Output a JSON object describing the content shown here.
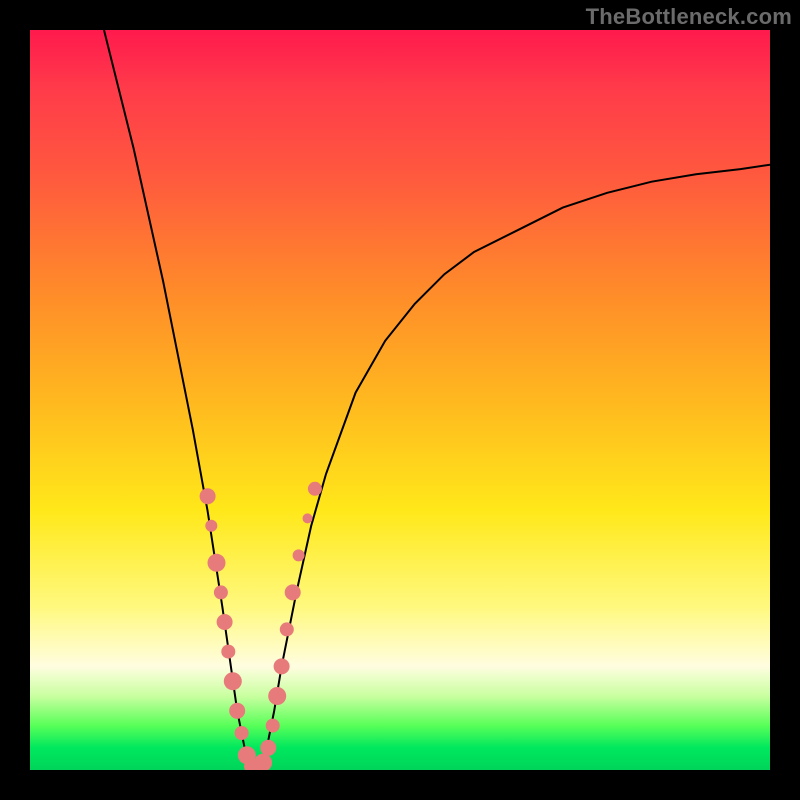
{
  "watermark": "TheBottleneck.com",
  "chart_data": {
    "type": "line",
    "title": "",
    "xlabel": "",
    "ylabel": "",
    "xlim": [
      0,
      100
    ],
    "ylim": [
      0,
      100
    ],
    "grid": false,
    "legend": false,
    "background_gradient_stops": [
      {
        "pos": 0,
        "color": "#ff1a4d"
      },
      {
        "pos": 8,
        "color": "#ff3b4a"
      },
      {
        "pos": 20,
        "color": "#ff5a3e"
      },
      {
        "pos": 35,
        "color": "#ff8a2a"
      },
      {
        "pos": 50,
        "color": "#ffb81f"
      },
      {
        "pos": 65,
        "color": "#ffe81a"
      },
      {
        "pos": 78,
        "color": "#fff97f"
      },
      {
        "pos": 86,
        "color": "#fffde0"
      },
      {
        "pos": 90,
        "color": "#c9ffa0"
      },
      {
        "pos": 94,
        "color": "#58ff58"
      },
      {
        "pos": 97,
        "color": "#00e85e"
      },
      {
        "pos": 100,
        "color": "#00d45a"
      }
    ],
    "series": [
      {
        "name": "bottleneck-curve",
        "color": "#000000",
        "stroke_width": 2,
        "x": [
          10,
          12,
          14,
          16,
          18,
          20,
          22,
          24,
          26,
          27,
          28,
          29,
          30,
          31,
          32,
          33,
          34,
          36,
          38,
          40,
          44,
          48,
          52,
          56,
          60,
          66,
          72,
          78,
          84,
          90,
          96,
          100
        ],
        "y": [
          100,
          92,
          84,
          75,
          66,
          56,
          46,
          35,
          22,
          15,
          8,
          3,
          0,
          0,
          3,
          8,
          14,
          24,
          33,
          40,
          51,
          58,
          63,
          67,
          70,
          73,
          76,
          78,
          79.5,
          80.5,
          81.2,
          81.8
        ]
      }
    ],
    "markers": {
      "name": "salmon-dots",
      "color": "#e77a7a",
      "radius_range": [
        5,
        11
      ],
      "points": [
        {
          "x": 24.0,
          "y": 37,
          "r": 8
        },
        {
          "x": 24.5,
          "y": 33,
          "r": 6
        },
        {
          "x": 25.2,
          "y": 28,
          "r": 9
        },
        {
          "x": 25.8,
          "y": 24,
          "r": 7
        },
        {
          "x": 26.3,
          "y": 20,
          "r": 8
        },
        {
          "x": 26.8,
          "y": 16,
          "r": 7
        },
        {
          "x": 27.4,
          "y": 12,
          "r": 9
        },
        {
          "x": 28.0,
          "y": 8,
          "r": 8
        },
        {
          "x": 28.6,
          "y": 5,
          "r": 7
        },
        {
          "x": 29.3,
          "y": 2,
          "r": 9
        },
        {
          "x": 30.0,
          "y": 0.5,
          "r": 8
        },
        {
          "x": 30.8,
          "y": 0.5,
          "r": 7
        },
        {
          "x": 31.5,
          "y": 1,
          "r": 9
        },
        {
          "x": 32.2,
          "y": 3,
          "r": 8
        },
        {
          "x": 32.8,
          "y": 6,
          "r": 7
        },
        {
          "x": 33.4,
          "y": 10,
          "r": 9
        },
        {
          "x": 34.0,
          "y": 14,
          "r": 8
        },
        {
          "x": 34.7,
          "y": 19,
          "r": 7
        },
        {
          "x": 35.5,
          "y": 24,
          "r": 8
        },
        {
          "x": 36.3,
          "y": 29,
          "r": 6
        },
        {
          "x": 37.5,
          "y": 34,
          "r": 5
        },
        {
          "x": 38.5,
          "y": 38,
          "r": 7
        }
      ]
    }
  }
}
